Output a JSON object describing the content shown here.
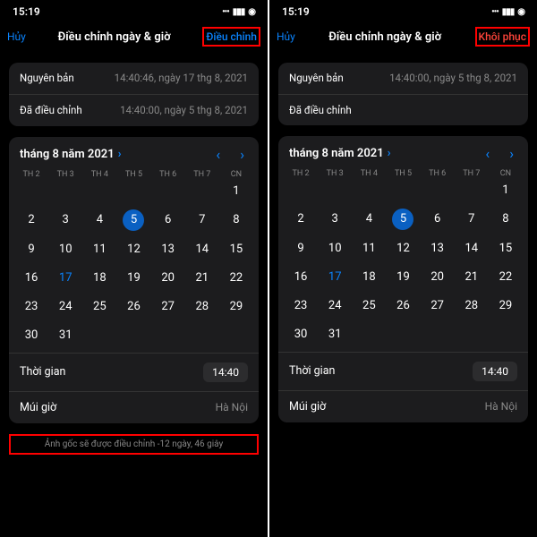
{
  "status": {
    "time": "15:19"
  },
  "header": {
    "cancel": "Hủy",
    "title": "Điều chỉnh ngày & giờ",
    "action_adjust": "Điều chỉnh",
    "action_restore": "Khôi phục"
  },
  "info": {
    "original_label": "Nguyên bản",
    "adjusted_label": "Đã điều chỉnh",
    "left_original_val": "14:40:46, ngày 17 thg 8, 2021",
    "left_adjusted_val": "14:40:00, ngày 5 thg 8, 2021",
    "right_original_val": "14:40:00, ngày 5 thg 8, 2021"
  },
  "cal": {
    "month_title": "tháng 8 năm 2021",
    "weekdays": [
      "TH 2",
      "TH 3",
      "TH 4",
      "TH 5",
      "TH 6",
      "TH 7",
      "CN"
    ]
  },
  "time": {
    "label": "Thời gian",
    "value": "14:40"
  },
  "tz": {
    "label": "Múi giờ",
    "value": "Hà Nội"
  },
  "footer": {
    "msg": "Ảnh gốc sẽ được điều chỉnh -12 ngày, 46 giây"
  }
}
